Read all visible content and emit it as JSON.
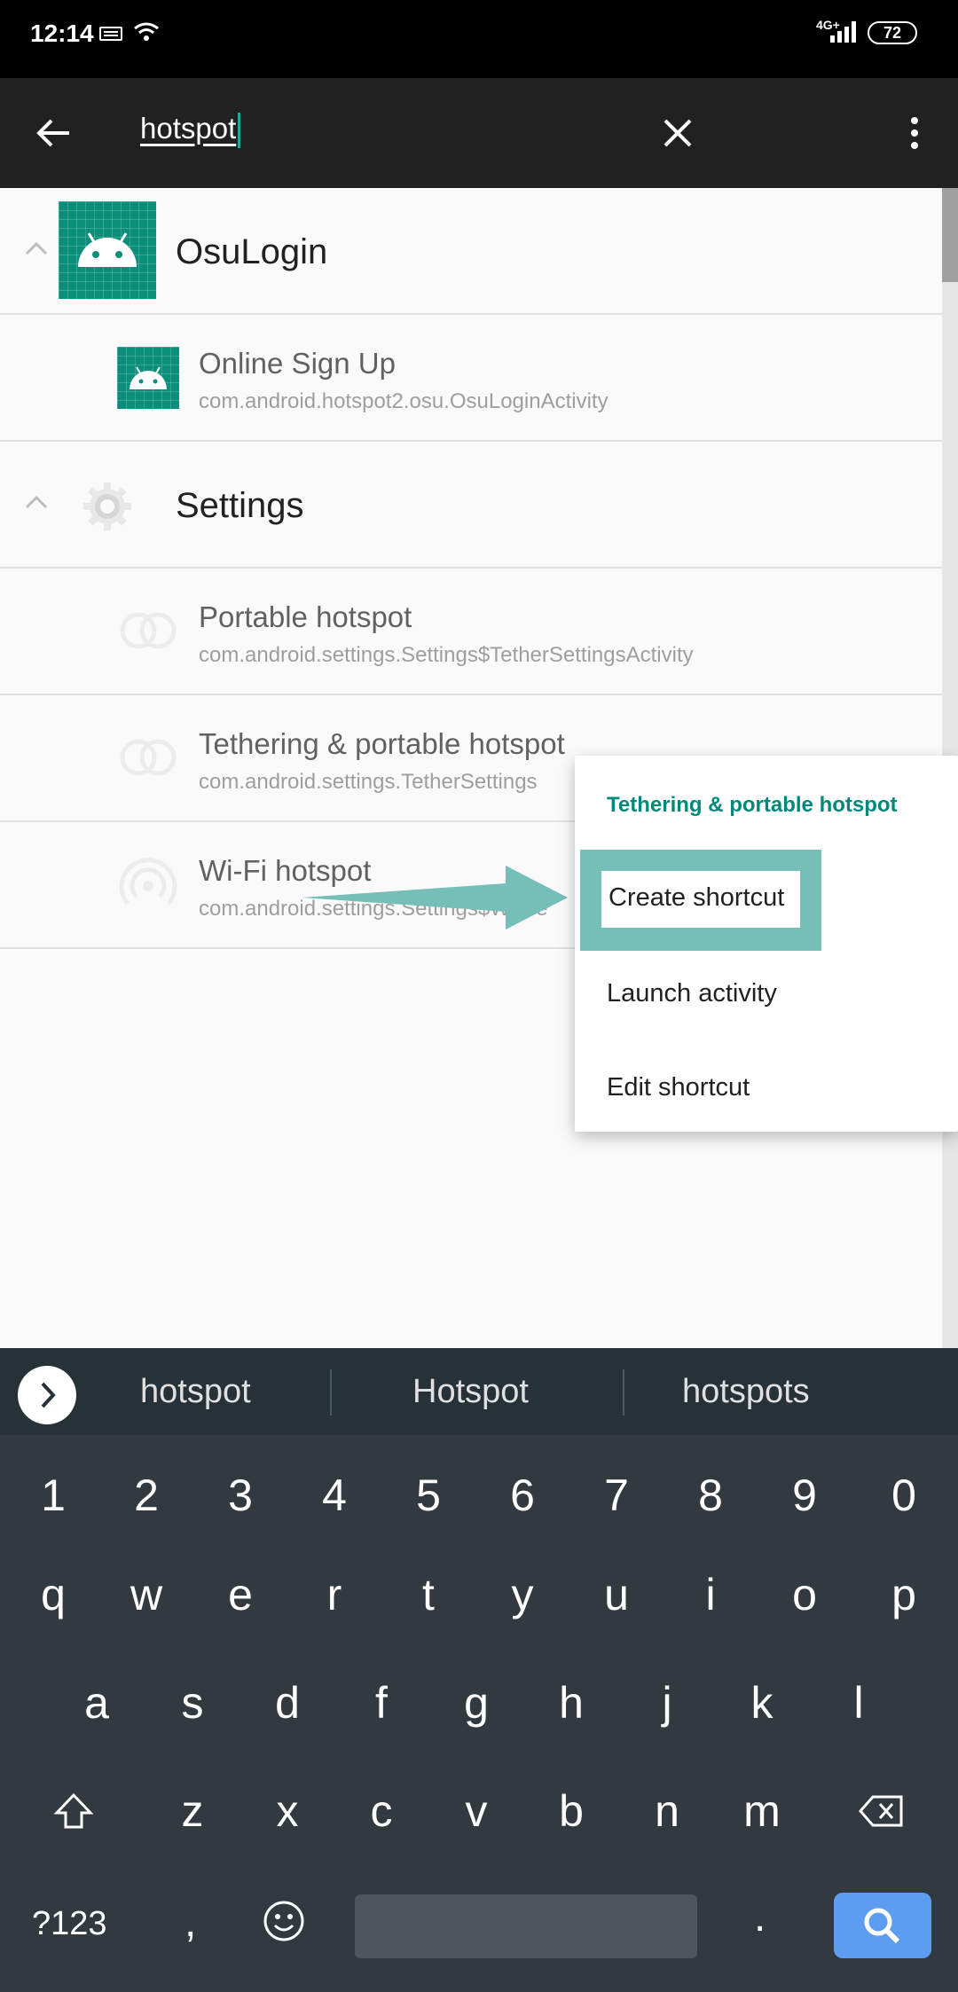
{
  "status_bar": {
    "time": "12:14",
    "network": "4G+",
    "battery": "72"
  },
  "toolbar": {
    "search_query": "hotspot"
  },
  "groups": [
    {
      "title": "OsuLogin",
      "items": [
        {
          "title": "Online Sign Up",
          "subtitle": "com.android.hotspot2.osu.OsuLoginActivity"
        }
      ]
    },
    {
      "title": "Settings",
      "items": [
        {
          "title": "Portable hotspot",
          "subtitle": "com.android.settings.Settings$TetherSettingsActivity"
        },
        {
          "title": "Tethering & portable hotspot",
          "subtitle": "com.android.settings.TetherSettings"
        },
        {
          "title": "Wi-Fi hotspot",
          "subtitle": "com.android.settings.Settings$WifiTe"
        }
      ]
    }
  ],
  "popup": {
    "title": "Tethering & portable hotspot",
    "items": [
      "Create shortcut",
      "Launch activity",
      "Edit shortcut"
    ]
  },
  "suggestions": [
    "hotspot",
    "Hotspot",
    "hotspots"
  ],
  "keyboard": {
    "numbers": [
      "1",
      "2",
      "3",
      "4",
      "5",
      "6",
      "7",
      "8",
      "9",
      "0"
    ],
    "row1": [
      "q",
      "w",
      "e",
      "r",
      "t",
      "y",
      "u",
      "i",
      "o",
      "p"
    ],
    "row2": [
      "a",
      "s",
      "d",
      "f",
      "g",
      "h",
      "j",
      "k",
      "l"
    ],
    "row3": [
      "z",
      "x",
      "c",
      "v",
      "b",
      "n",
      "m"
    ],
    "symbols_label": "?123",
    "comma": ",",
    "period": "."
  },
  "colors": {
    "accent": "#00897b",
    "highlight": "#76bfb8",
    "toolbar": "#212121",
    "keyboard": "#323a40"
  }
}
